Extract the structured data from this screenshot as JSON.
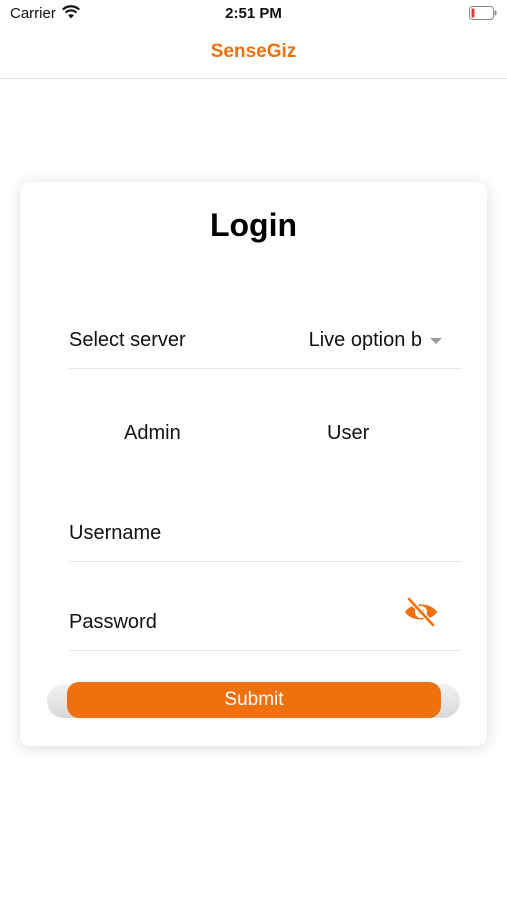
{
  "status_bar": {
    "carrier": "Carrier",
    "time": "2:51 PM"
  },
  "nav": {
    "title": "SenseGiz"
  },
  "login": {
    "title": "Login",
    "server_label": "Select server",
    "server_value": "Live option b",
    "roles": [
      "Admin",
      "User"
    ],
    "username_label": "Username",
    "password_label": "Password",
    "submit_label": "Submit"
  },
  "colors": {
    "accent": "#F07010",
    "card_bg": "#FFFFFF",
    "divider": "#E6E6E6"
  },
  "icons": {
    "wifi": "wifi-icon",
    "battery": "battery-icon",
    "password_visibility": "eye-slash-icon",
    "dropdown": "chevron-down-icon"
  }
}
